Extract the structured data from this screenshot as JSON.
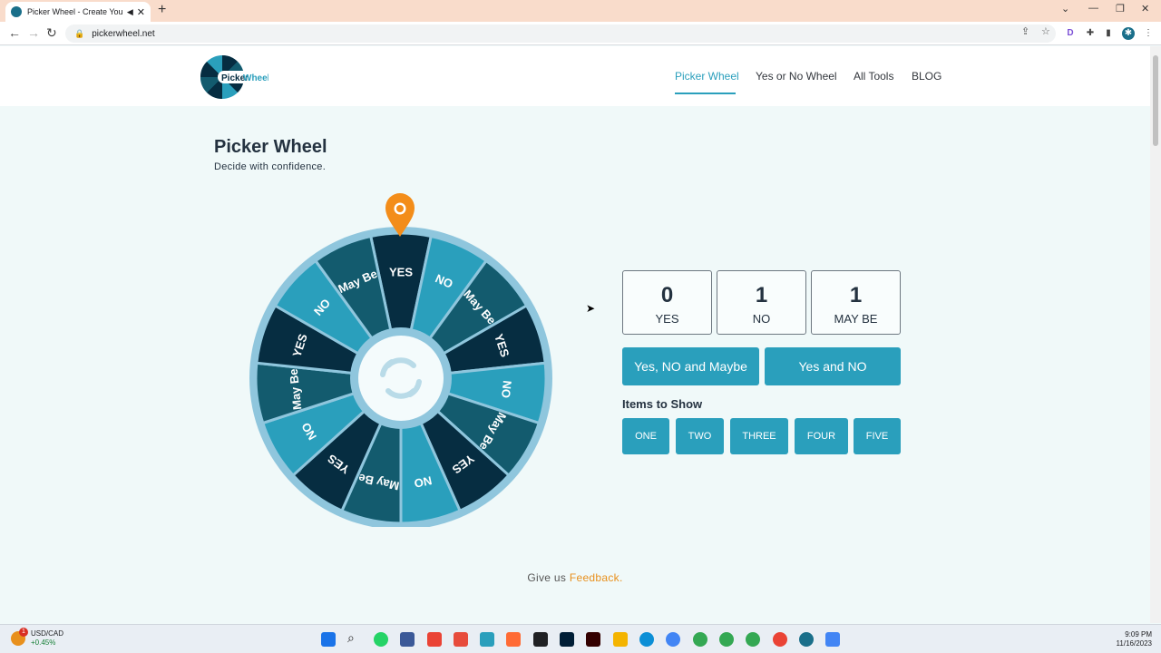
{
  "browser": {
    "tab_title": "Picker Wheel - Create Your",
    "url": "pickerwheel.net"
  },
  "header": {
    "logo_text_a": "Picker",
    "logo_text_b": "Wheel",
    "nav": [
      "Picker Wheel",
      "Yes or No Wheel",
      "All Tools",
      "BLOG"
    ]
  },
  "main": {
    "title": "Picker Wheel",
    "subtitle": "Decide with confidence."
  },
  "wheel": {
    "segments": [
      "YES",
      "NO",
      "May Be",
      "YES",
      "NO",
      "May Be",
      "YES",
      "NO",
      "May Be",
      "YES",
      "NO",
      "May Be",
      "YES",
      "NO",
      "May Be"
    ],
    "colors": {
      "dark": "#062d41",
      "light": "#2a9fbc",
      "mid": "#135b6e",
      "rim": "#8fc6dd",
      "pin": "#f38d1a"
    }
  },
  "stats": [
    {
      "count": "0",
      "label": "YES"
    },
    {
      "count": "1",
      "label": "NO"
    },
    {
      "count": "1",
      "label": "MAY BE"
    }
  ],
  "buttons": {
    "option1": "Yes, NO and Maybe",
    "option2": "Yes and NO"
  },
  "items_to_show": {
    "label": "Items to Show",
    "options": [
      "ONE",
      "TWO",
      "THREE",
      "FOUR",
      "FIVE"
    ]
  },
  "feedback": {
    "prefix": "Give us",
    "link": "Feedback."
  },
  "taskbar": {
    "ticker": "USD/CAD",
    "change": "+0.45%",
    "badge": "1",
    "time": "9:09 PM",
    "date": "11/16/2023"
  }
}
